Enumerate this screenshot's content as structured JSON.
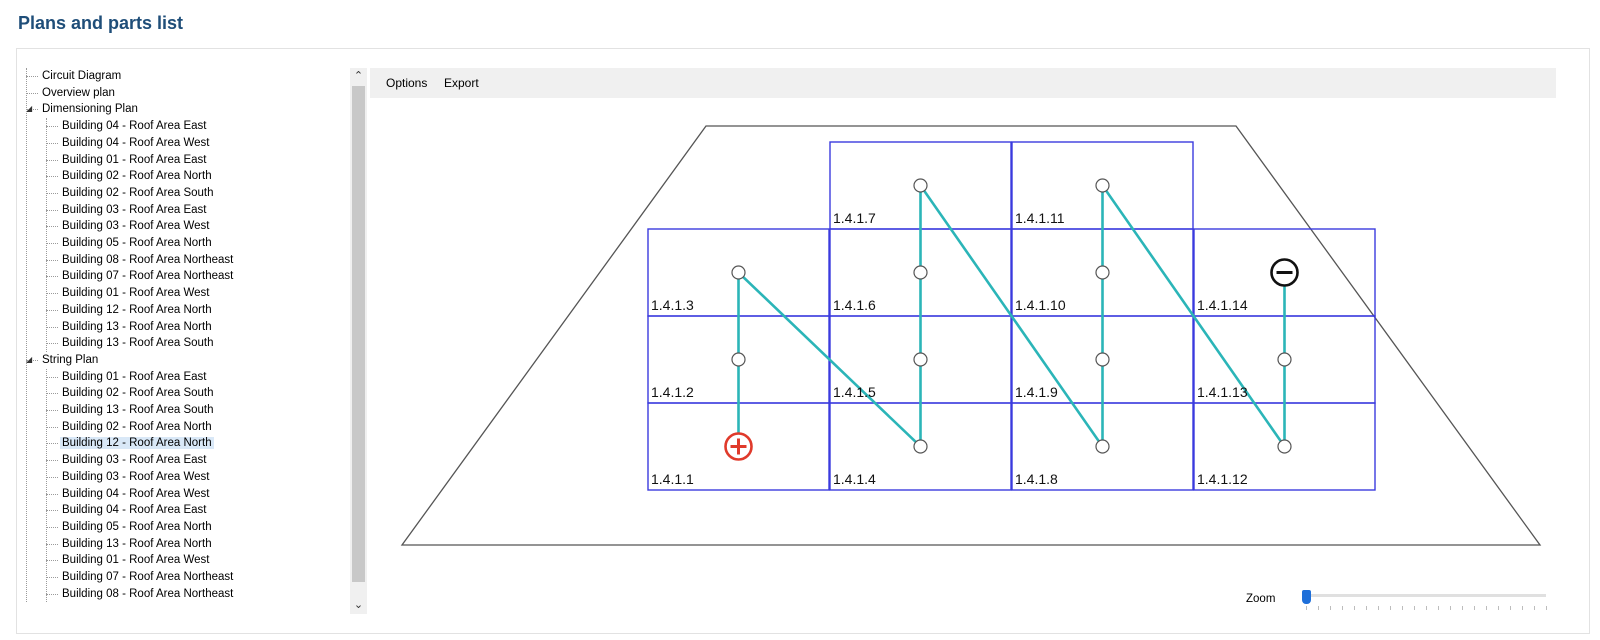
{
  "page": {
    "title": "Plans and parts list"
  },
  "tree": {
    "root_items": [
      "Circuit Diagram",
      "Overview plan"
    ],
    "groups": [
      {
        "label": "Dimensioning Plan",
        "expanded": true,
        "children": [
          "Building 04 - Roof Area East",
          "Building 04 - Roof Area West",
          "Building 01 - Roof Area East",
          "Building 02 - Roof Area North",
          "Building 02 - Roof Area South",
          "Building 03 - Roof Area East",
          "Building 03 - Roof Area West",
          "Building 05 - Roof Area North",
          "Building 08 - Roof Area Northeast",
          "Building 07 - Roof Area Northeast",
          "Building 01 - Roof Area West",
          "Building 12 - Roof Area North",
          "Building 13 - Roof Area North",
          "Building 13 - Roof Area South"
        ]
      },
      {
        "label": "String Plan",
        "expanded": true,
        "children": [
          "Building 01 - Roof Area East",
          "Building 02 - Roof Area South",
          "Building 13 - Roof Area South",
          "Building 02 - Roof Area North",
          "Building 12 - Roof Area North",
          "Building 03 - Roof Area East",
          "Building 03 - Roof Area West",
          "Building 04 - Roof Area West",
          "Building 04 - Roof Area East",
          "Building 05 - Roof Area North",
          "Building 13 - Roof Area North",
          "Building 01 - Roof Area West",
          "Building 07 - Roof Area Northeast",
          "Building 08 - Roof Area Northeast"
        ]
      }
    ],
    "selected": "String Plan/Building 12 - Roof Area North"
  },
  "toolbar": {
    "options_label": "Options",
    "export_label": "Export"
  },
  "plan": {
    "modules": [
      {
        "id": "1.4.1.1",
        "col": 0,
        "row": 3
      },
      {
        "id": "1.4.1.2",
        "col": 0,
        "row": 2
      },
      {
        "id": "1.4.1.3",
        "col": 0,
        "row": 1
      },
      {
        "id": "1.4.1.4",
        "col": 1,
        "row": 3
      },
      {
        "id": "1.4.1.5",
        "col": 1,
        "row": 2
      },
      {
        "id": "1.4.1.6",
        "col": 1,
        "row": 1
      },
      {
        "id": "1.4.1.7",
        "col": 1,
        "row": 0
      },
      {
        "id": "1.4.1.8",
        "col": 2,
        "row": 3
      },
      {
        "id": "1.4.1.9",
        "col": 2,
        "row": 2
      },
      {
        "id": "1.4.1.10",
        "col": 2,
        "row": 1
      },
      {
        "id": "1.4.1.11",
        "col": 2,
        "row": 0
      },
      {
        "id": "1.4.1.12",
        "col": 3,
        "row": 3
      },
      {
        "id": "1.4.1.13",
        "col": 3,
        "row": 2
      },
      {
        "id": "1.4.1.14",
        "col": 3,
        "row": 1
      }
    ],
    "string_path": [
      "1.4.1.1",
      "1.4.1.2",
      "1.4.1.3",
      "1.4.1.4",
      "1.4.1.5",
      "1.4.1.6",
      "1.4.1.7",
      "1.4.1.8",
      "1.4.1.9",
      "1.4.1.10",
      "1.4.1.11",
      "1.4.1.12",
      "1.4.1.13",
      "1.4.1.14"
    ],
    "positive_terminal": "1.4.1.1",
    "negative_terminal": "1.4.1.14",
    "colors": {
      "roof_outline": "#555555",
      "module_border": "#3b3bde",
      "string_line": "#2bb5b8",
      "positive": "#e03a2b",
      "negative": "#111111"
    }
  },
  "zoom": {
    "label": "Zoom",
    "level": 0
  }
}
